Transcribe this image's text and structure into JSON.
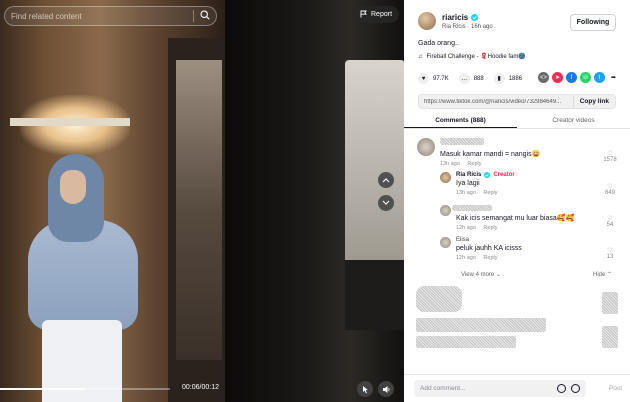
{
  "video": {
    "search_placeholder": "Find related content",
    "report_label": "Report",
    "time": "00:06/00:12",
    "progress": 0.5
  },
  "author": {
    "username": "riaricis",
    "display": "Ria Ricis",
    "age": "16h ago",
    "follow_label": "Following",
    "caption": "Gada orang..",
    "music": "Fireball Challenge - 🧣Hoodie fam🌚"
  },
  "stats": {
    "likes": "97.7K",
    "comments": "888",
    "saves": "1886"
  },
  "share_icons": [
    "embed-icon",
    "paper-plane-icon",
    "facebook-icon",
    "whatsapp-icon",
    "twitter-icon",
    "share-arrow-icon"
  ],
  "link": {
    "url": "https://www.tiktok.com/@riaricis/video/732984649...",
    "copy_label": "Copy link"
  },
  "tabs": {
    "comments": "Comments (888)",
    "creator": "Creator videos"
  },
  "comments": [
    {
      "name": "",
      "text": "Masuk kamar mandi = nangis😄",
      "meta_time": "13h ago",
      "reply": "Reply",
      "likes": "1578"
    },
    {
      "name": "Ria Ricis",
      "badge": "Creator",
      "text": "Iya lagii",
      "meta_time": "13h ago",
      "reply": "Reply",
      "likes": "649"
    },
    {
      "name": "",
      "text": "Kak icis semangat mu luar biasa🥰🥰",
      "meta_time": "12h ago",
      "reply": "Reply",
      "likes": "54"
    },
    {
      "name": "Elisa",
      "text": "peluk jauhh KA icisss",
      "meta_time": "12h ago",
      "reply": "Reply",
      "likes": "13"
    }
  ],
  "view_more": "View 4 more",
  "hide": "Hide",
  "add_comment": {
    "placeholder": "Add comment...",
    "post_label": "Post"
  }
}
